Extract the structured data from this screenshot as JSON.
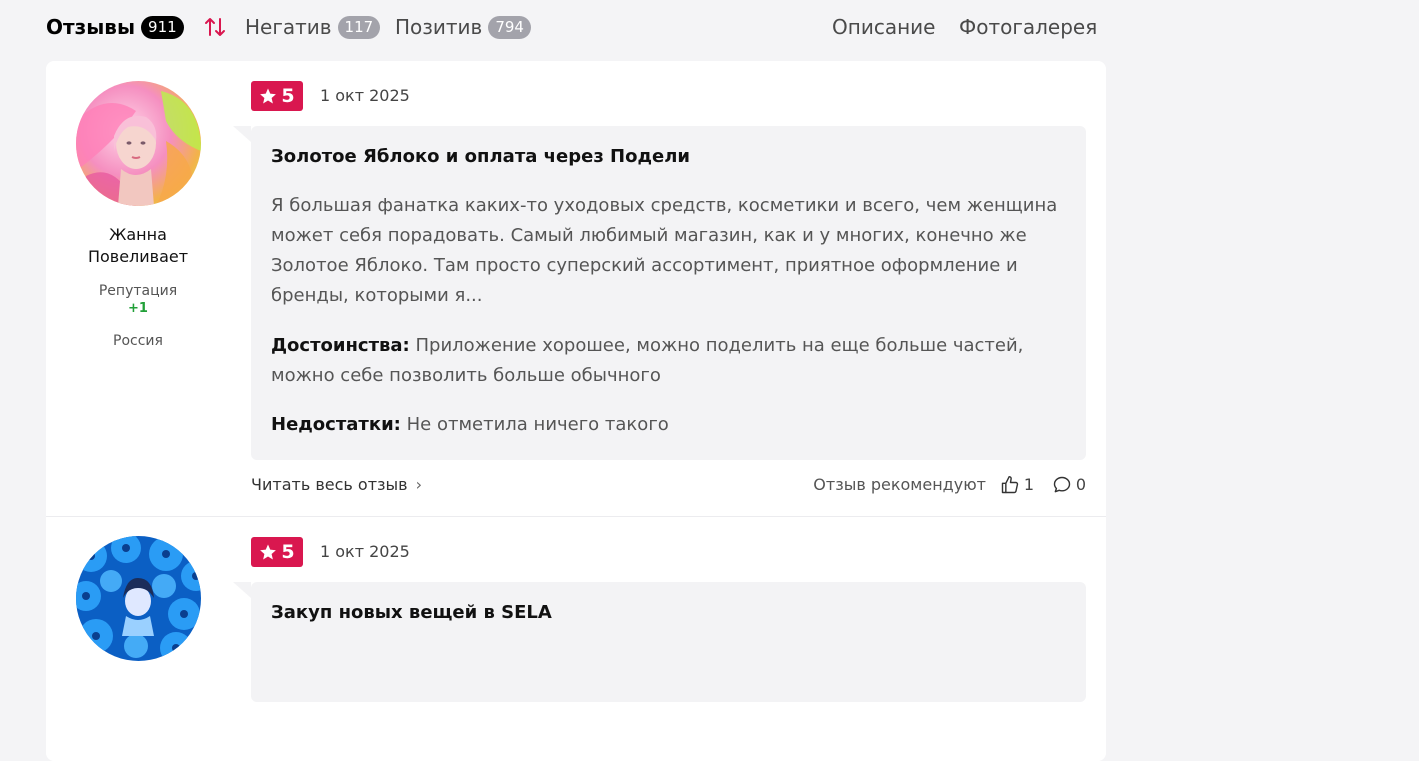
{
  "tabs": {
    "reviews_label": "Отзывы",
    "reviews_count": "911",
    "negative_label": "Негатив",
    "negative_count": "117",
    "positive_label": "Позитив",
    "positive_count": "794",
    "description_label": "Описание",
    "gallery_label": "Фотогалерея"
  },
  "colors": {
    "accent": "#d9174f",
    "reputation_positive": "#21a038"
  },
  "reviews": [
    {
      "author_name_line1": "Жанна",
      "author_name_line2": "Повеливает",
      "reputation_label": "Репутация",
      "reputation_value": "+1",
      "country": "Россия",
      "rating": "5",
      "date": "1 окт 2025",
      "title": "Золотое Яблоко и оплата через Подели",
      "text": "Я большая фанатка каких-то уходовых средств, косметики и всего, чем женщина может себя порадовать. Самый любимый магазин, как и у многих, конечно же Золотое Яблоко. Там просто суперский ассортимент, приятное оформление и бренды, которыми я...",
      "pros_label": "Достоинства:",
      "pros": "Приложение хорошее, можно поделить на еще больше частей, можно себе позволить больше обычного",
      "cons_label": "Недостатки:",
      "cons": "Не отметила ничего такого",
      "read_more": "Читать весь отзыв",
      "recommend_label": "Отзыв рекомендуют",
      "likes": "1",
      "comments": "0"
    },
    {
      "rating": "5",
      "date": "1 окт 2025",
      "title": "Закуп новых вещей в SELA"
    }
  ]
}
